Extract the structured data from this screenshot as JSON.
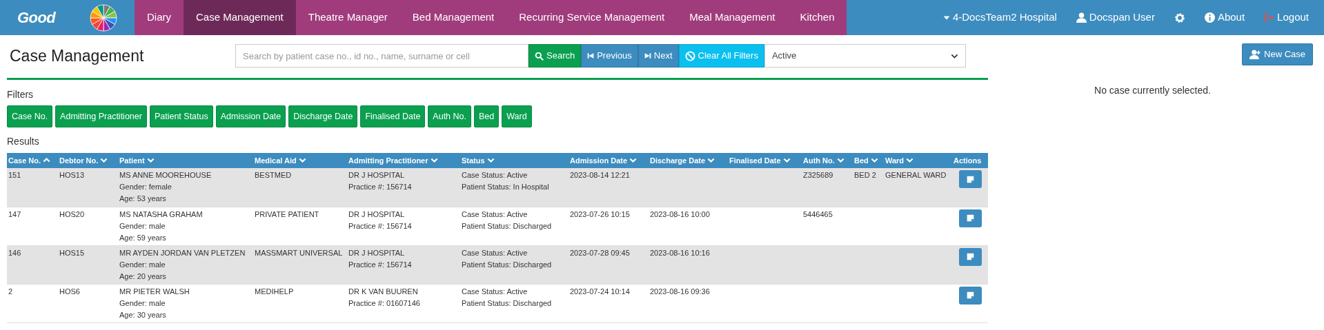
{
  "nav": {
    "brand": "Good",
    "items": [
      {
        "label": "Diary",
        "selected": false
      },
      {
        "label": "Case Management",
        "selected": true
      },
      {
        "label": "Theatre Manager",
        "selected": false
      },
      {
        "label": "Bed Management",
        "selected": false
      },
      {
        "label": "Recurring Service Management",
        "selected": false
      },
      {
        "label": "Meal Management",
        "selected": false
      },
      {
        "label": "Kitchen",
        "selected": false
      }
    ],
    "right": [
      {
        "kind": "dropdown",
        "label": "4-DocsTeam2 Hospital"
      },
      {
        "kind": "user",
        "label": "Docspan User"
      },
      {
        "kind": "settings"
      },
      {
        "kind": "info",
        "label": "About"
      },
      {
        "kind": "logout",
        "label": "Logout"
      }
    ]
  },
  "page_title": "Case Management",
  "search": {
    "placeholder": "Search by patient case no., id no., name, surname or cell"
  },
  "toolbar": [
    {
      "kind": "search",
      "label": "Search"
    },
    {
      "kind": "previous",
      "label": "Previous"
    },
    {
      "kind": "next",
      "label": "Next"
    },
    {
      "kind": "clear",
      "label": "Clear All Filters"
    }
  ],
  "status_select": {
    "value": "Active"
  },
  "filters_label": "Filters",
  "filters": [
    "Case No.",
    "Admitting Practitioner",
    "Patient Status",
    "Admission Date",
    "Discharge Date",
    "Finalised Date",
    "Auth No.",
    "Bed",
    "Ward"
  ],
  "results_label": "Results",
  "table": {
    "columns": [
      {
        "label": "Case No.",
        "sortable": true,
        "sorted": true
      },
      {
        "label": "Debtor No.",
        "sortable": true,
        "sorted": false
      },
      {
        "label": "Patient",
        "sortable": true,
        "sorted": false
      },
      {
        "label": "Medical Aid",
        "sortable": true,
        "sorted": false
      },
      {
        "label": "Admitting Practitioner",
        "sortable": true,
        "sorted": false
      },
      {
        "label": "Status",
        "sortable": true,
        "sorted": false
      },
      {
        "label": "Admission Date",
        "sortable": true,
        "sorted": false
      },
      {
        "label": "Discharge Date",
        "sortable": true,
        "sorted": false
      },
      {
        "label": "Finalised Date",
        "sortable": true,
        "sorted": false
      },
      {
        "label": "Auth No.",
        "sortable": true,
        "sorted": false
      },
      {
        "label": "Bed",
        "sortable": true,
        "sorted": false
      },
      {
        "label": "Ward",
        "sortable": true,
        "sorted": false
      },
      {
        "label": "Actions",
        "sortable": false
      }
    ],
    "rows": [
      {
        "cells": [
          [
            "151"
          ],
          [
            "HOS13"
          ],
          [
            "MS ANNE MOOREHOUSE",
            "Gender: female",
            "Age: 53 years"
          ],
          [
            "BESTMED"
          ],
          [
            "DR J HOSPITAL",
            "Practice #: 156714"
          ],
          [
            "Case Status: Active",
            "Patient Status: In Hospital"
          ],
          [
            "2023-08-14 12:21"
          ],
          [],
          [],
          [
            "Z325689"
          ],
          [
            "BED 2"
          ],
          [
            "GENERAL WARD"
          ]
        ]
      },
      {
        "cells": [
          [
            "147"
          ],
          [
            "HOS20"
          ],
          [
            "MS NATASHA GRAHAM",
            "Gender: male",
            "Age: 59 years"
          ],
          [
            "PRIVATE PATIENT"
          ],
          [
            "DR J HOSPITAL",
            "Practice #: 156714"
          ],
          [
            "Case Status: Active",
            "Patient Status: Discharged"
          ],
          [
            "2023-07-26 10:15"
          ],
          [
            "2023-08-16 10:00"
          ],
          [],
          [
            "5446465"
          ],
          [],
          []
        ]
      },
      {
        "cells": [
          [
            "146"
          ],
          [
            "HOS15"
          ],
          [
            "MR AYDEN JORDAN VAN PLETZEN",
            "Gender: male",
            "Age: 20 years"
          ],
          [
            "MASSMART UNIVERSAL"
          ],
          [
            "DR J HOSPITAL",
            "Practice #: 156714"
          ],
          [
            "Case Status: Active",
            "Patient Status: Discharged"
          ],
          [
            "2023-07-28 09:45"
          ],
          [
            "2023-08-16 10:16"
          ],
          [],
          [],
          [],
          []
        ]
      },
      {
        "cells": [
          [
            "2"
          ],
          [
            "HOS6"
          ],
          [
            "MR PIETER WALSH",
            "Gender: male",
            "Age: 30 years"
          ],
          [
            "MEDIHELP"
          ],
          [
            "DR K VAN BUUREN",
            "Practice #: 01607146"
          ],
          [
            "Case Status: Active",
            "Patient Status: Discharged"
          ],
          [
            "2023-07-24 10:14"
          ],
          [
            "2023-08-16 09:36"
          ],
          [],
          [],
          [],
          []
        ]
      }
    ]
  },
  "side": {
    "new_case": "New Case",
    "empty_message": "No case currently selected."
  }
}
